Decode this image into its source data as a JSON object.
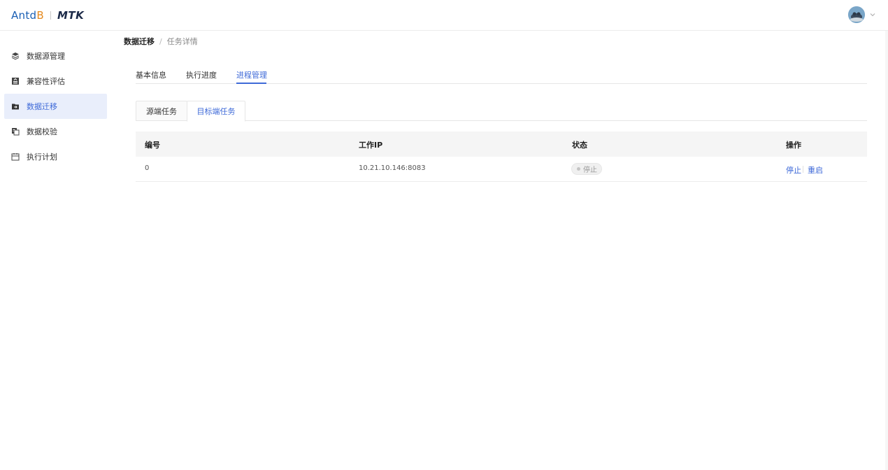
{
  "header": {
    "logo_part1": "Antd",
    "logo_part2": "B",
    "product": "MTK"
  },
  "sidebar": {
    "items": [
      {
        "label": "数据源管理",
        "icon": "layers-icon"
      },
      {
        "label": "兼容性评估",
        "icon": "assessment-icon"
      },
      {
        "label": "数据迁移",
        "icon": "folder-transfer-icon"
      },
      {
        "label": "数据校验",
        "icon": "compare-icon"
      },
      {
        "label": "执行计划",
        "icon": "calendar-icon"
      }
    ],
    "active_index": 2
  },
  "breadcrumb": {
    "current": "数据迁移",
    "separator": "/",
    "last": "任务详情"
  },
  "tabs": {
    "items": [
      {
        "label": "基本信息"
      },
      {
        "label": "执行进度"
      },
      {
        "label": "进程管理"
      }
    ],
    "active_index": 2
  },
  "subtabs": {
    "items": [
      {
        "label": "源端任务"
      },
      {
        "label": "目标端任务"
      }
    ],
    "active_index": 1
  },
  "table": {
    "columns": [
      "编号",
      "工作IP",
      "状态",
      "操作"
    ],
    "rows": [
      {
        "id": "0",
        "ip": "10.21.10.146:8083",
        "status": "停止",
        "actions": [
          "停止",
          "重启"
        ]
      }
    ]
  },
  "colors": {
    "accent": "#3f6ad8",
    "active_bg": "#e9eefb",
    "logo_blue": "#1a5fb4",
    "logo_orange": "#e58a1f"
  }
}
